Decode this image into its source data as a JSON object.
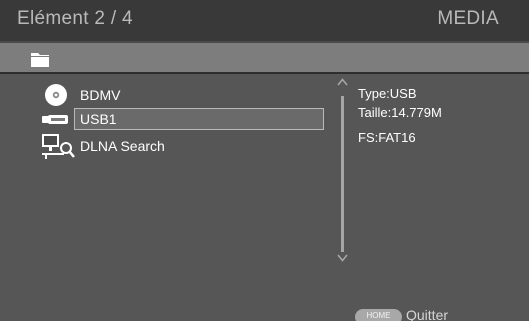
{
  "header": {
    "title": "Elément 2 / 4",
    "mode": "MEDIA"
  },
  "list": {
    "items": [
      {
        "label": "BDMV",
        "icon": "disc-icon"
      },
      {
        "label": "USB1",
        "icon": "usb-icon",
        "selected": true
      },
      {
        "label": "DLNA Search",
        "icon": "dlna-search-icon"
      }
    ]
  },
  "info": {
    "type": "Type:USB",
    "size": "Taille:14.779M",
    "fs": "FS:FAT16"
  },
  "footer": {
    "home_label": "HOME",
    "quit_label": "Quitter"
  },
  "colors": {
    "background": "#565656",
    "header": "#393939",
    "pathbar": "#7d7d7d",
    "selection_border": "#b9b9b9"
  }
}
